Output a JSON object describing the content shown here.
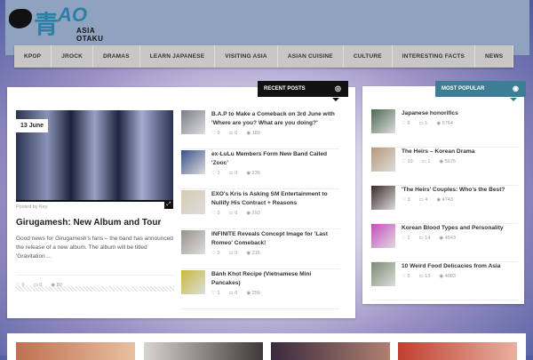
{
  "site": {
    "logo_kanji": "青",
    "logo_ao": "AO",
    "logo_text": "ASIA OTAKU"
  },
  "nav": [
    "KPOP",
    "JROCK",
    "DRAMAS",
    "LEARN JAPANESE",
    "VISITING ASIA",
    "ASIAN CUISINE",
    "CULTURE",
    "INTERESTING FACTS",
    "NEWS"
  ],
  "featured": {
    "date": "13 June",
    "posted_by": "Posted by Key",
    "title": "Girugamesh: New Album and Tour",
    "excerpt": "Good news for Girugamesh's fans – the band has announced the release of a new album. The album will be titled 'Gravitation ...",
    "likes": "0",
    "comments": "0",
    "views": "80"
  },
  "recent": {
    "header": "RECENT POSTS",
    "items": [
      {
        "title": "B.A.P to Make a Comeback on 3rd June with 'Where are you? What are you doing?'",
        "likes": "0",
        "comments": "0",
        "views": "180",
        "color": "#7a7f88"
      },
      {
        "title": "ex-LuLu Members Form New Band Called 'Zooc'",
        "likes": "1",
        "comments": "0",
        "views": "236",
        "color": "#3b4f8a"
      },
      {
        "title": "EXO's Kris is Asking SM Entertainment to Nullify His Contract + Reasons",
        "likes": "0",
        "comments": "0",
        "views": "293",
        "color": "#d8cbb0"
      },
      {
        "title": "INFINITE Reveals Concept Image for 'Last Romeo' Comeback!",
        "likes": "0",
        "comments": "0",
        "views": "215",
        "color": "#9a928a"
      },
      {
        "title": "Bánh Khọt Recipe (Vietnamese Mini Pancakes)",
        "likes": "1",
        "comments": "0",
        "views": "256",
        "color": "#c9b83a"
      }
    ]
  },
  "popular": {
    "header": "MOST POPULAR",
    "items": [
      {
        "title": "Japanese honorifics",
        "likes": "6",
        "comments": "1",
        "views": "5764",
        "color": "#4a6a50"
      },
      {
        "title": "The Heirs – Korean Drama",
        "likes": "10",
        "comments": "1",
        "views": "5675",
        "color": "#b89878"
      },
      {
        "title": "'The Heirs' Couples: Who's the Best?",
        "likes": "3",
        "comments": "4",
        "views": "4743",
        "color": "#3a2a2a"
      },
      {
        "title": "Korean Blood Types and Personality",
        "likes": "1",
        "comments": "14",
        "views": "4543",
        "color": "#c84ac0"
      },
      {
        "title": "10 Weird Food Delicacies from Asia",
        "likes": "5",
        "comments": "13",
        "views": "4083",
        "color": "#7a8a70"
      }
    ]
  }
}
